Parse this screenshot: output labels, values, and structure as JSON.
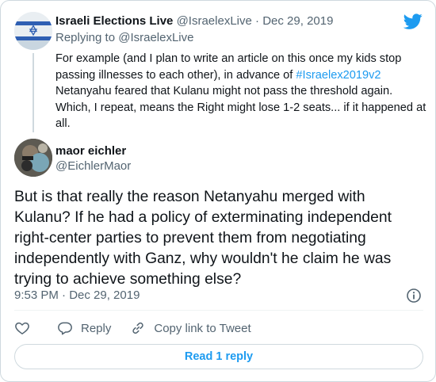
{
  "parent_tweet": {
    "author_name": "Israeli Elections Live",
    "author_handle": "@IsraelexLive",
    "separator": "·",
    "date": "Dec 29, 2019",
    "replying_to": "Replying to @IsraelexLive",
    "text_before_link": "For example (and I plan to write an article on this once my kids stop passing illnesses to each other), in advance of ",
    "hashtag": "#Israelex2019v2",
    "text_after_link": " Netanyahu feared that Kulanu might not pass the threshold again. Which, I repeat, means the Right might lose 1-2 seats... if it happened at all."
  },
  "main_tweet": {
    "author_name": "maor eichler",
    "author_handle": "@EichlerMaor",
    "text": "But is that really the reason Netanyahu merged with Kulanu? If he had a policy of exterminating independent right-center parties to prevent them from negotiating independently with Ganz, why wouldn't he claim he was trying to achieve something else?",
    "timestamp": "9:53 PM · Dec 29, 2019"
  },
  "actions": {
    "reply_label": "Reply",
    "copy_link_label": "Copy link to Tweet"
  },
  "read_replies_label": "Read 1 reply",
  "colors": {
    "accent": "#1d9bf0",
    "secondary_text": "#536471",
    "border": "#cfd9de"
  },
  "icons": [
    "twitter-bird-icon",
    "info-icon",
    "heart-icon",
    "reply-icon",
    "link-icon"
  ]
}
